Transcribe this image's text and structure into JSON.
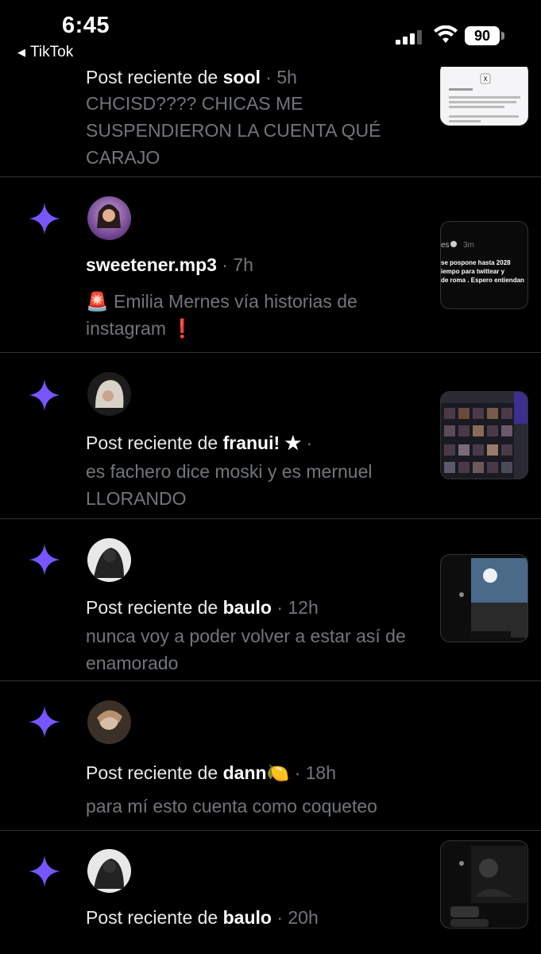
{
  "status_bar": {
    "time": "6:45",
    "back_app": "TikTok",
    "battery": "90"
  },
  "rows": [
    {
      "prefix": "Post reciente de ",
      "user": "sool",
      "meta": " · 5h",
      "text": "CHCISD???? CHICAS ME SUSPENDIERON LA CUENTA QUÉ CARAJO",
      "thumb_icon": "screenshot-thumbnail"
    },
    {
      "prefix": "",
      "user": "sweetener.mp3",
      "meta": " · 7h",
      "text": "🚨 Emilia Mernes vía historias de instagram ❗",
      "thumb_icon": "tweet-screenshot-thumbnail"
    },
    {
      "prefix": "Post reciente de ",
      "user": "franui! ★",
      "meta": " ·",
      "text": "es fachero dice moski y es mernuel LLORANDO",
      "thumb_icon": "video-grid-thumbnail"
    },
    {
      "prefix": "Post reciente de ",
      "user": "baulo",
      "meta": " · 12h",
      "text": "nunca voy a poder volver a estar así de enamorado",
      "thumb_icon": "chat-screenshot-thumbnail"
    },
    {
      "prefix": "Post reciente de ",
      "user": "dann🍋",
      "meta": " · 18h",
      "text": "para mí esto cuenta como coqueteo",
      "thumb_icon": "chat-screenshot-thumbnail"
    },
    {
      "prefix": "Post reciente de ",
      "user": "baulo",
      "meta": " · 20h",
      "text": "",
      "thumb_icon": "chat-screenshot-thumbnail"
    }
  ],
  "colors": {
    "background": "#000000",
    "sparkle": "#7856ff",
    "muted": "#71767b",
    "divider": "#2f3336"
  }
}
